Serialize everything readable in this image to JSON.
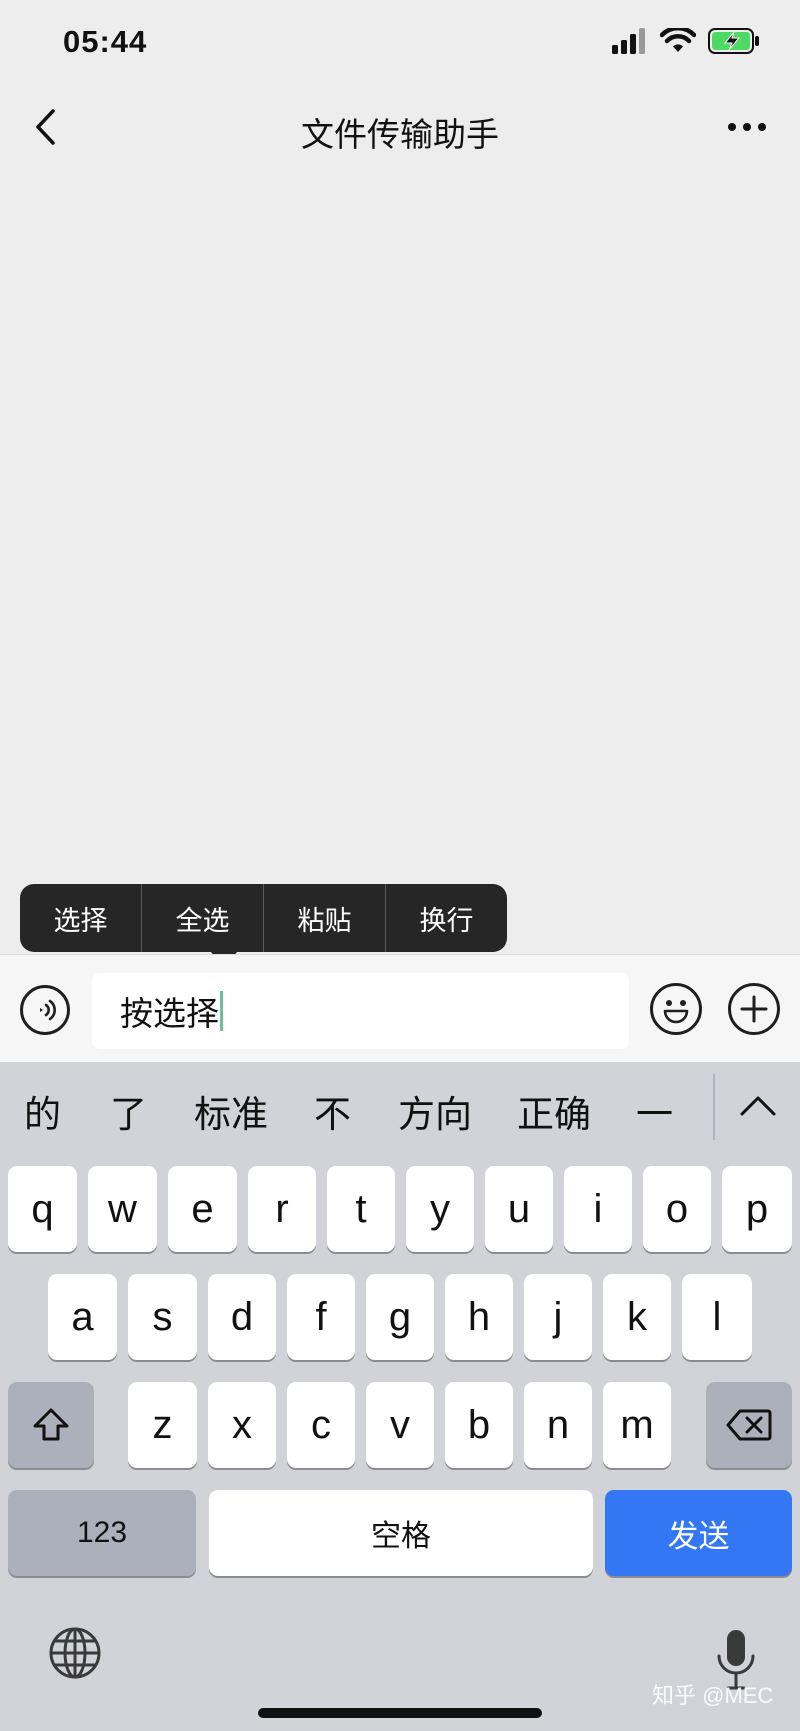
{
  "status_bar": {
    "time": "05:44"
  },
  "nav": {
    "title": "文件传输助手"
  },
  "context_menu": {
    "items": [
      "选择",
      "全选",
      "粘贴",
      "换行"
    ]
  },
  "input": {
    "text": "按选择"
  },
  "candidates": {
    "items": [
      "的",
      "了",
      "标准",
      "不",
      "方向",
      "正确",
      "一"
    ]
  },
  "keyboard": {
    "row1": [
      "q",
      "w",
      "e",
      "r",
      "t",
      "y",
      "u",
      "i",
      "o",
      "p"
    ],
    "row2": [
      "a",
      "s",
      "d",
      "f",
      "g",
      "h",
      "j",
      "k",
      "l"
    ],
    "row3": [
      "z",
      "x",
      "c",
      "v",
      "b",
      "n",
      "m"
    ],
    "numbers_label": "123",
    "space_label": "空格",
    "send_label": "发送"
  },
  "watermark": "知乎 @MEC",
  "colors": {
    "send_blue": "#3477f4",
    "battery_green": "#4cd964",
    "caret_green": "#6fc08e"
  }
}
